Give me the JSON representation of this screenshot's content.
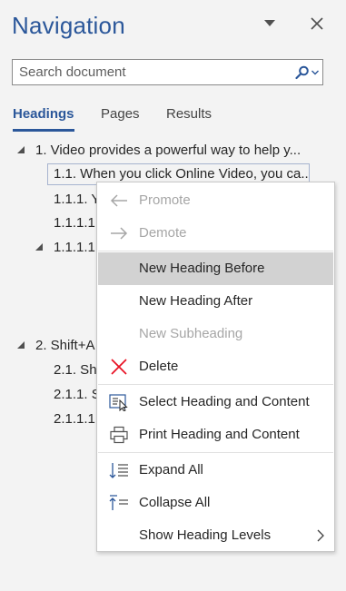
{
  "pane": {
    "title": "Navigation"
  },
  "search": {
    "placeholder": "Search document"
  },
  "tabs": [
    {
      "label": "Headings"
    },
    {
      "label": "Pages"
    },
    {
      "label": "Results"
    }
  ],
  "tree": [
    {
      "label": "1. Video provides a powerful way to help y..."
    },
    {
      "label": "1.1. When you click Online Video, you ca..."
    },
    {
      "label": "1.1.1. Yo"
    },
    {
      "label": "1.1.1.1."
    },
    {
      "label": "1.1.1.1."
    },
    {
      "label": "2. Shift+A"
    },
    {
      "label": "2.1. Shi"
    },
    {
      "label": "2.1.1. S"
    },
    {
      "label": "2.1.1.1."
    }
  ],
  "menu": {
    "promote": "Promote",
    "demote": "Demote",
    "new_heading_before": "New Heading Before",
    "new_heading_after": "New Heading After",
    "new_subheading": "New Subheading",
    "delete": "Delete",
    "select_heading_content": "Select Heading and Content",
    "print_heading_content": "Print Heading and Content",
    "expand_all": "Expand All",
    "collapse_all": "Collapse All",
    "show_heading_levels": "Show Heading Levels"
  },
  "colors": {
    "accent": "#2b579a",
    "delete_icon": "#e81123",
    "menu_hover": "#d2d2d2"
  }
}
